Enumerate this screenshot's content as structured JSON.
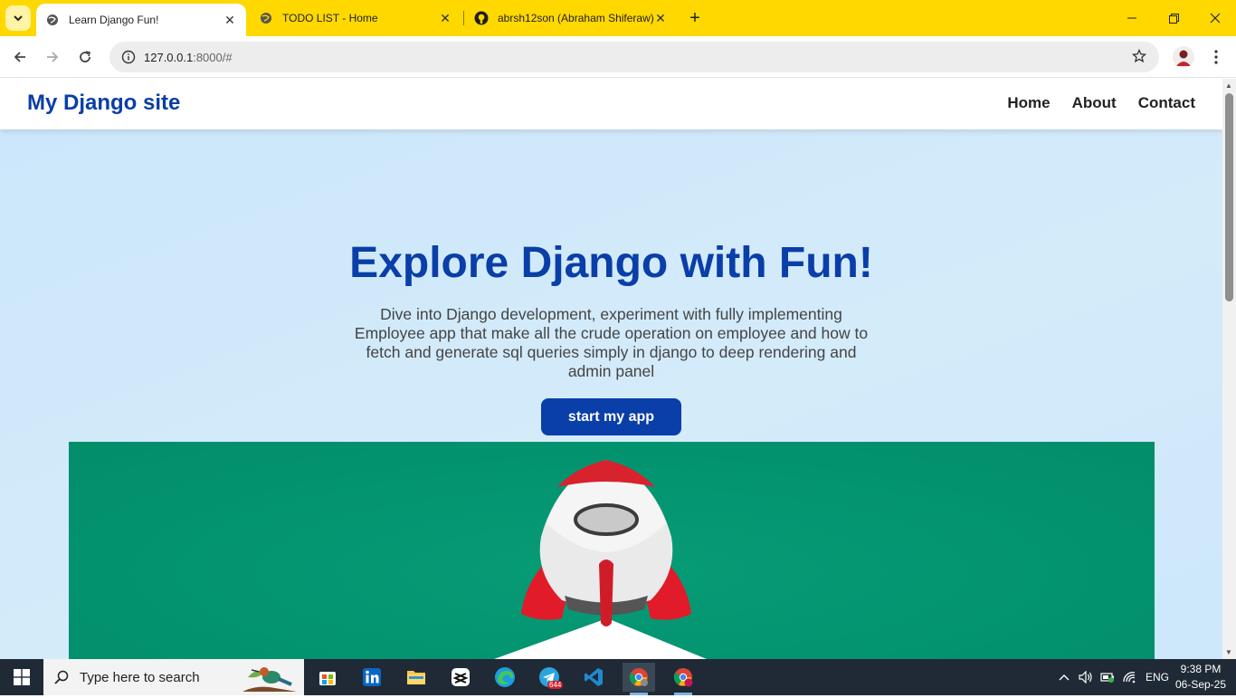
{
  "browser": {
    "tabs": [
      {
        "title": "Learn Django Fun!",
        "active": true
      },
      {
        "title": "TODO LIST - Home",
        "active": false
      },
      {
        "title": "abrsh12son (Abraham Shiferaw)",
        "active": false
      }
    ],
    "address": {
      "host": "127.0.0.1",
      "rest": ":8000/#"
    },
    "accent_color": "#ffd800"
  },
  "site": {
    "brand": "My Django site",
    "nav": [
      "Home",
      "About",
      "Contact"
    ],
    "hero": {
      "title": "Explore Django with Fun!",
      "description": "Dive into Django development, experiment with fully implementing Employee app that make all the crude operation on employee and how to fetch and generate sql queries simply in django to deep rendering and admin panel",
      "cta_label": "start my app",
      "image_icon": "rocket-illustration"
    },
    "brand_color": "#0a3ea8",
    "hero_bg": "#cfe8fb"
  },
  "taskbar": {
    "search_placeholder": "Type here to search",
    "telegram_badge": "644",
    "language": "ENG",
    "time": "9:38 PM",
    "date": "06-Sep-25"
  }
}
